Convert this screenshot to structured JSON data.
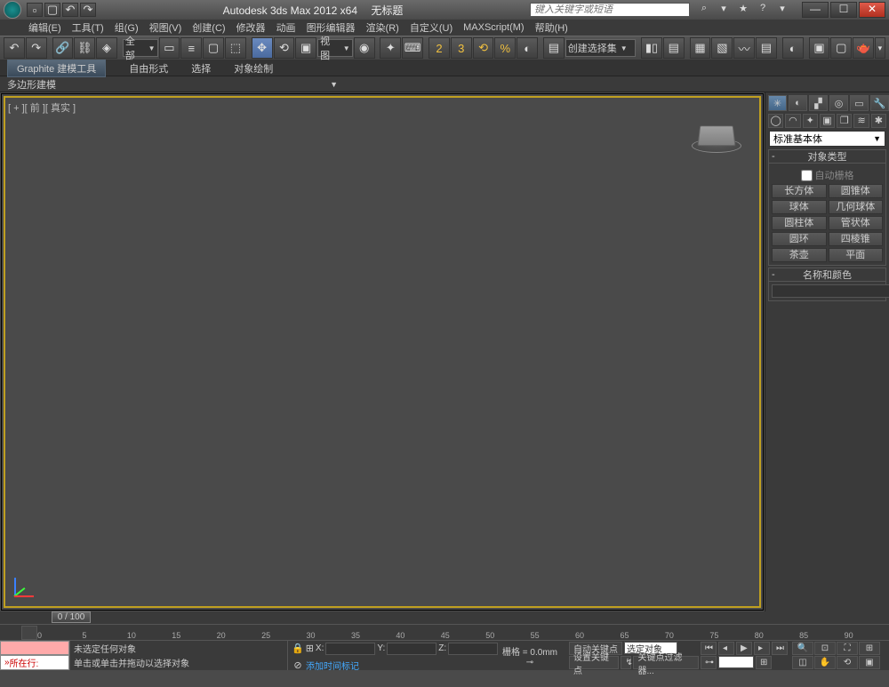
{
  "titlebar": {
    "app_title": "Autodesk 3ds Max 2012 x64",
    "doc_title": "无标题",
    "search_placeholder": "键入关键字或短语"
  },
  "menubar": {
    "items": [
      "编辑(E)",
      "工具(T)",
      "组(G)",
      "视图(V)",
      "创建(C)",
      "修改器",
      "动画",
      "图形编辑器",
      "渲染(R)",
      "自定义(U)",
      "MAXScript(M)",
      "帮助(H)"
    ]
  },
  "maintoolbar": {
    "filter_label": "全部",
    "view_label": "视图",
    "selset_label": "创建选择集"
  },
  "ribbon": {
    "tabs": [
      "Graphite 建模工具",
      "自由形式",
      "选择",
      "对象绘制"
    ],
    "subtitle": "多边形建模"
  },
  "viewport": {
    "label": "[ + ][ 前 ][ 真实 ]"
  },
  "cmdpanel": {
    "dropdown": "标准基本体",
    "rollout_objtype": "对象类型",
    "autogrid": "自动栅格",
    "objects": [
      [
        "长方体",
        "圆锥体"
      ],
      [
        "球体",
        "几何球体"
      ],
      [
        "圆柱体",
        "管状体"
      ],
      [
        "圆环",
        "四棱锥"
      ],
      [
        "茶壶",
        "平面"
      ]
    ],
    "rollout_namecolor": "名称和颜色"
  },
  "timeline": {
    "slider": "0 / 100",
    "ticks": [
      0,
      5,
      10,
      15,
      20,
      25,
      30,
      35,
      40,
      45,
      50,
      55,
      60,
      65,
      70,
      75,
      80,
      85,
      90
    ]
  },
  "statusbar": {
    "location_label": "所在行:",
    "prompt1": "未选定任何对象",
    "prompt2": "单击或单击并拖动以选择对象",
    "addtag": "添加时间标记",
    "x": "X:",
    "y": "Y:",
    "z": "Z:",
    "grid": "栅格 = 0.0mm",
    "autokey": "自动关键点",
    "setkey": "设置关键点",
    "selobj": "选定对象",
    "keyfilter": "关键点过滤器..."
  }
}
